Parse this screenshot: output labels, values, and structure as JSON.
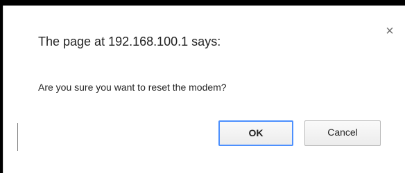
{
  "dialog": {
    "title": "The page at 192.168.100.1 says:",
    "message": "Are you sure you want to reset the modem?",
    "close_glyph": "×",
    "ok_label": "OK",
    "cancel_label": "Cancel"
  },
  "icons": {
    "close": "close-icon"
  },
  "colors": {
    "ok_focus_border": "#4d90fe",
    "button_border": "#b8b8b8",
    "text": "#222222"
  }
}
